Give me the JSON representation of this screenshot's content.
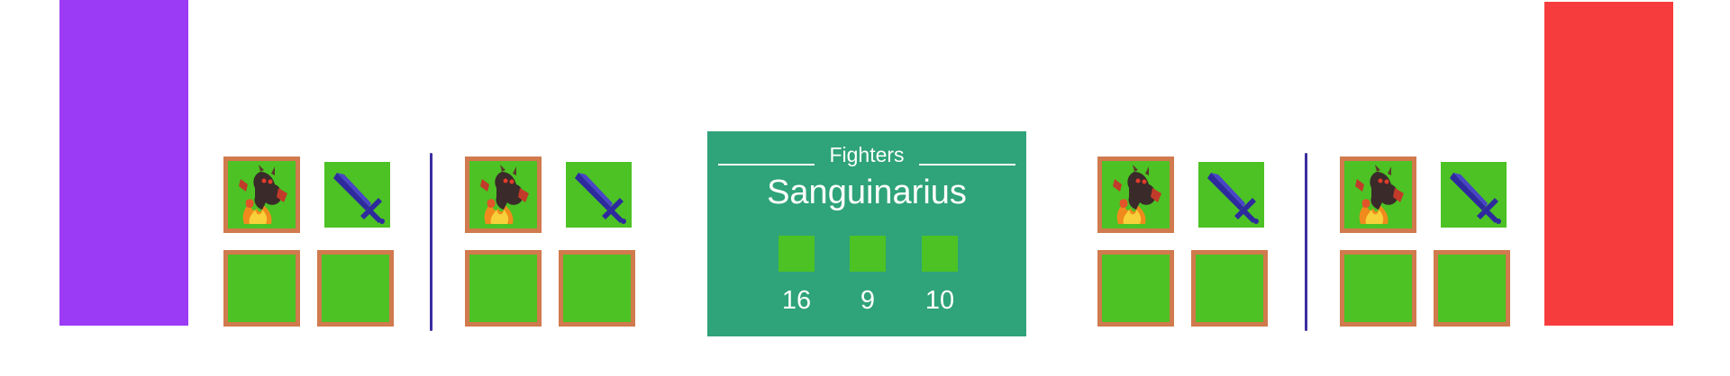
{
  "colors": {
    "left_player": "#9b3bf5",
    "right_player": "#f73c3d",
    "slot_fill": "#4cc224",
    "slot_border": "#d07a4d",
    "divider": "#3b2ea0",
    "panel_bg": "#2fa37a",
    "panel_text": "#ffffff"
  },
  "icons": {
    "hero": "fire-demon-icon",
    "weapon": "blue-sword-icon"
  },
  "panel": {
    "title": "Fighters",
    "name": "Sanguinarius",
    "stats": [
      "16",
      "9",
      "10"
    ]
  }
}
